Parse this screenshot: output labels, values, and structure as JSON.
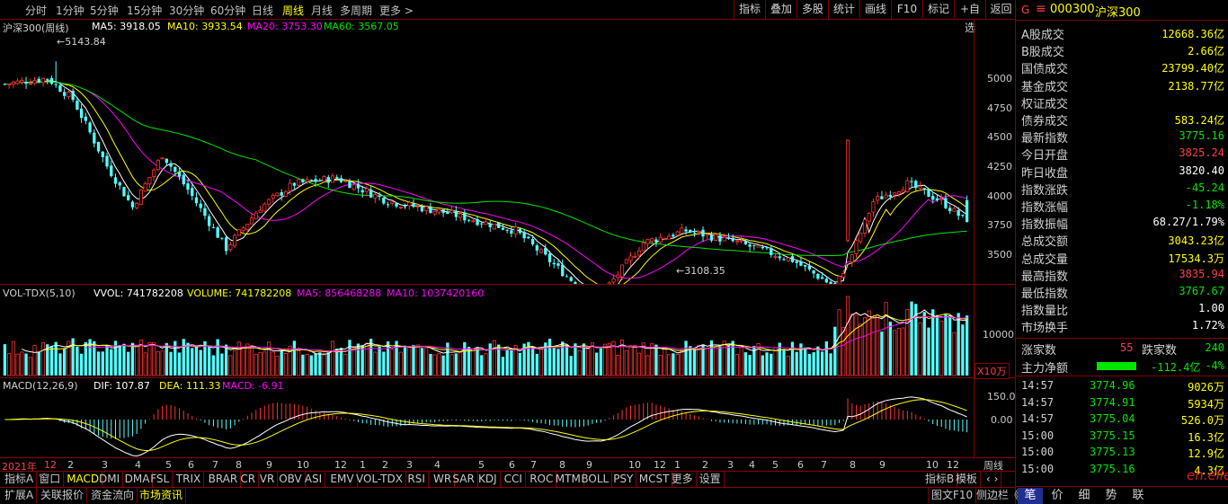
{
  "periods": [
    "分时",
    "1分钟",
    "5分钟",
    "15分钟",
    "30分钟",
    "60分钟",
    "日线",
    "周线",
    "月线",
    "多周期",
    "更多 >"
  ],
  "active_period": "周线",
  "toolbar": [
    "指标",
    "叠加",
    "多股",
    "统计",
    "画线",
    "F10",
    "标记",
    "+自选",
    "返回"
  ],
  "main_chart": {
    "title": "沪深300(周线)",
    "ma5": "MA5: 3918.05",
    "ma10": "MA10: 3933.54",
    "ma20": "MA20: 3753.30",
    "ma60": "MA60: 3567.05",
    "high_label": "5143.84",
    "low_label": "3108.35",
    "y_ticks": [
      "5000",
      "4750",
      "4500",
      "4250",
      "4000",
      "3750",
      "3500"
    ],
    "colors": {
      "up": "#ff3232",
      "down": "#54ffff",
      "ma5": "#ffffff",
      "ma10": "#ffff00",
      "ma20": "#ff00ff",
      "ma60": "#00e600"
    }
  },
  "vol_chart": {
    "title": "VOL-TDX(5,10)",
    "vvol": "VVOL: 741782208",
    "volume": "VOLUME: 741782208",
    "ma5": "MA5: 856468288",
    "ma10": "MA10: 1037420160",
    "y_tick": "10000",
    "unit": "X10万"
  },
  "macd_chart": {
    "title": "MACD(12,26,9)",
    "dif": "DIF: 107.87",
    "dea": "DEA: 111.33",
    "macd": "MACD: -6.91",
    "y_ticks": [
      "150.0",
      "0.00"
    ]
  },
  "x_axis": [
    "2021年",
    "12",
    "2",
    "3",
    "4",
    "5",
    "6",
    "7",
    "8",
    "9",
    "10",
    "12",
    "1",
    "2",
    "3",
    "4",
    "5",
    "6",
    "7",
    "8",
    "9",
    "10",
    "12",
    "1",
    "2",
    "3",
    "4",
    "5",
    "6",
    "7",
    "8",
    "9",
    "10",
    "12",
    "1"
  ],
  "x_axis_right": "周线",
  "indicator_tabs": [
    "指标A",
    "窗口",
    "MACD",
    "DMI",
    "DMA",
    "FSL",
    "TRIX",
    "BRAR",
    "CR",
    "VR",
    "OBV",
    "ASI",
    "EMV",
    "VOL-TDX",
    "RSI",
    "WR",
    "SAR",
    "KDJ",
    "CCI",
    "ROC",
    "MTM",
    "BOLL",
    "PSY",
    "MCST",
    "更多",
    "设置"
  ],
  "indicator_tabs_right": [
    "指标B",
    "模板"
  ],
  "bottom_tabs": [
    "扩展A",
    "关联报价",
    "资金流向",
    "市场资讯"
  ],
  "bottom_right": [
    "图文F10",
    "侧边栏《"
  ],
  "right_panel": {
    "header_code": "000300",
    "header_name": "沪深300",
    "header_flag": "G",
    "stats": [
      {
        "k": "A股成交",
        "v": "12668.36亿",
        "c": "yellow"
      },
      {
        "k": "B股成交",
        "v": "2.66亿",
        "c": "yellow"
      },
      {
        "k": "国债成交",
        "v": "23799.40亿",
        "c": "yellow"
      },
      {
        "k": "基金成交",
        "v": "2138.77亿",
        "c": "yellow"
      },
      {
        "k": "权证成交",
        "v": "",
        "c": "yellow"
      },
      {
        "k": "债券成交",
        "v": "583.24亿",
        "c": "yellow"
      },
      {
        "k": "最新指数",
        "v": "3775.16",
        "c": "green"
      },
      {
        "k": "今日开盘",
        "v": "3825.24",
        "c": "red"
      },
      {
        "k": "昨日收盘",
        "v": "3820.40",
        "c": "white"
      },
      {
        "k": "指数涨跌",
        "v": "-45.24",
        "c": "green"
      },
      {
        "k": "指数涨幅",
        "v": "-1.18%",
        "c": "green"
      },
      {
        "k": "指数振幅",
        "v": "68.27/1.79%",
        "c": "white"
      },
      {
        "k": "总成交额",
        "v": "3043.23亿",
        "c": "yellow"
      },
      {
        "k": "总成交量",
        "v": "17534.3万",
        "c": "yellow"
      },
      {
        "k": "最高指数",
        "v": "3835.94",
        "c": "red"
      },
      {
        "k": "最低指数",
        "v": "3767.67",
        "c": "green"
      },
      {
        "k": "指数量比",
        "v": "1.00",
        "c": "white"
      },
      {
        "k": "市场换手",
        "v": "1.72%",
        "c": "white"
      }
    ],
    "rise_fall": {
      "rise_label": "涨家数",
      "rise": "55",
      "fall_label": "跌家数",
      "fall": "240"
    },
    "main_flow": {
      "label": "主力净额",
      "value": "-112.4亿",
      "pct": "-4%"
    },
    "ticks": [
      {
        "t": "14:57",
        "p": "3774.96",
        "v": "9026万"
      },
      {
        "t": "14:57",
        "p": "3774.91",
        "v": "5934万"
      },
      {
        "t": "14:57",
        "p": "3775.04",
        "v": "526.0万"
      },
      {
        "t": "15:00",
        "p": "3775.15",
        "v": "16.3亿"
      },
      {
        "t": "15:00",
        "p": "3775.13",
        "v": "12.9亿"
      },
      {
        "t": "15:00",
        "p": "3775.16",
        "v": "4.3亿"
      }
    ],
    "bottom_tabs": [
      "笔",
      "价",
      "细",
      "势",
      "联"
    ],
    "watermark": "eh.ellenet"
  },
  "chart_data": {
    "type": "candlestick",
    "series_label": "沪深300(周线)",
    "close_start": 4950,
    "close_end": 3775.16,
    "high": 5143.84,
    "low": 3108.35,
    "ylim": [
      3000,
      5200
    ]
  }
}
